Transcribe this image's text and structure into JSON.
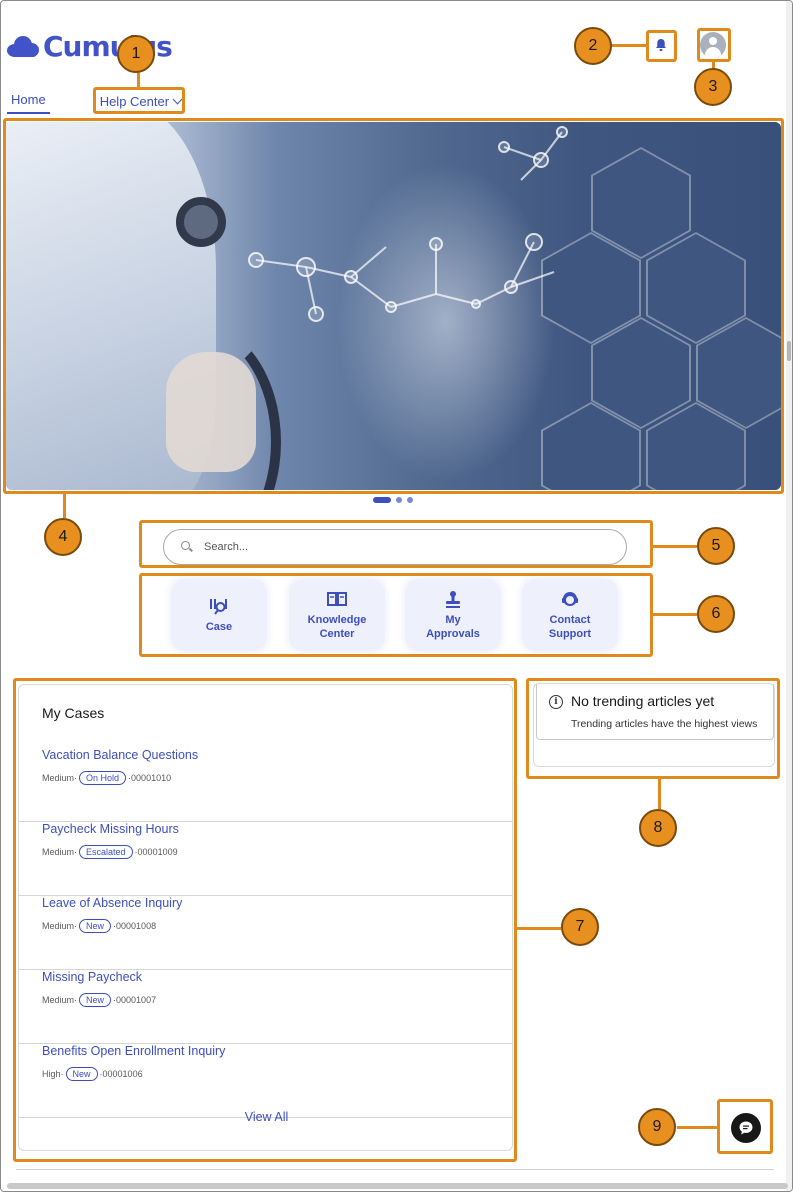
{
  "brand": {
    "logo_text": "Cumulus",
    "accent": "#3d4fbf",
    "logo_color": "#4253c9"
  },
  "nav": {
    "home": "Home",
    "help_center": "Help Center"
  },
  "header_icons": {
    "notifications": "bell-icon",
    "profile": "avatar-icon"
  },
  "hero": {
    "carousel_slides": 3,
    "active_slide": 1
  },
  "search": {
    "placeholder": "Search..."
  },
  "tiles": [
    {
      "label_1": "Case",
      "label_2": "",
      "icon": "case-icon"
    },
    {
      "label_1": "Knowledge",
      "label_2": "Center",
      "icon": "book-icon"
    },
    {
      "label_1": "My",
      "label_2": "Approvals",
      "icon": "stamp-icon"
    },
    {
      "label_1": "Contact",
      "label_2": "Support",
      "icon": "support-agent-icon"
    }
  ],
  "my_cases": {
    "title": "My Cases",
    "items": [
      {
        "title": "Vacation Balance Questions",
        "priority": "Medium",
        "status": "On Hold",
        "number": "00001010"
      },
      {
        "title": "Paycheck Missing Hours",
        "priority": "Medium",
        "status": "Escalated",
        "number": "00001009"
      },
      {
        "title": "Leave of Absence Inquiry",
        "priority": "Medium",
        "status": "New",
        "number": "00001008"
      },
      {
        "title": "Missing Paycheck",
        "priority": "Medium",
        "status": "New",
        "number": "00001007"
      },
      {
        "title": "Benefits Open Enrollment Inquiry",
        "priority": "High",
        "status": "New",
        "number": "00001006"
      }
    ],
    "view_all": "View All",
    "separator": " · "
  },
  "trending": {
    "heading": "No trending articles yet",
    "subtext": "Trending articles have the highest views"
  },
  "annotations": [
    "1",
    "2",
    "3",
    "4",
    "5",
    "6",
    "7",
    "8",
    "9"
  ],
  "annotation_color": "#e08a1e"
}
